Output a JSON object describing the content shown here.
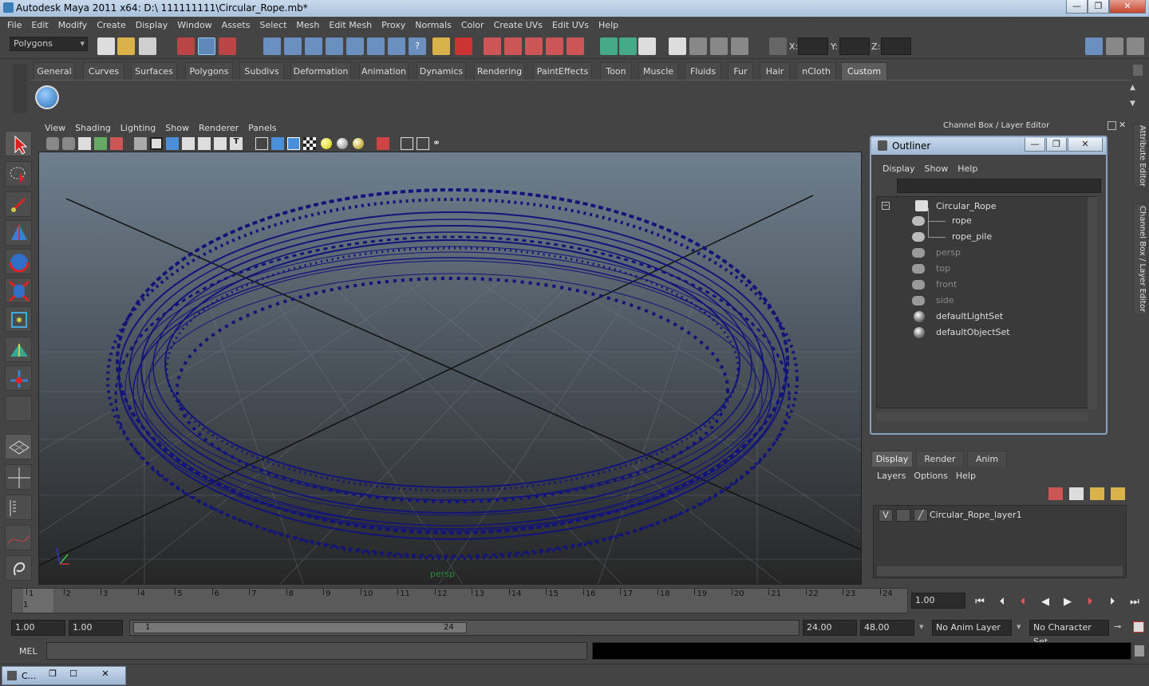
{
  "window": {
    "title": "Autodesk Maya 2011 x64: D:\\ 111111111\\Circular_Rope.mb*",
    "min": "—",
    "max": "❐",
    "close": "✕"
  },
  "menubar": [
    "File",
    "Edit",
    "Modify",
    "Create",
    "Display",
    "Window",
    "Assets",
    "Select",
    "Mesh",
    "Edit Mesh",
    "Proxy",
    "Normals",
    "Color",
    "Create UVs",
    "Edit UVs",
    "Help"
  ],
  "status": {
    "mode": "Polygons",
    "x_label": "X:",
    "y_label": "Y:",
    "z_label": "Z:"
  },
  "shelf_tabs": [
    "General",
    "Curves",
    "Surfaces",
    "Polygons",
    "Subdivs",
    "Deformation",
    "Animation",
    "Dynamics",
    "Rendering",
    "PaintEffects",
    "Toon",
    "Muscle",
    "Fluids",
    "Fur",
    "Hair",
    "nCloth",
    "Custom"
  ],
  "shelf_active": "Custom",
  "panel_menu": [
    "View",
    "Shading",
    "Lighting",
    "Show",
    "Renderer",
    "Panels"
  ],
  "viewport": {
    "camera_label": "persp"
  },
  "channel_box_title": "Channel Box / Layer Editor",
  "side_tabs": {
    "attribute": "Attribute Editor",
    "channel": "Channel Box / Layer Editor"
  },
  "outliner": {
    "title": "Outliner",
    "menu": [
      "Display",
      "Show",
      "Help"
    ],
    "items": [
      {
        "label": "Circular_Rope",
        "dim": false
      },
      {
        "label": "rope",
        "dim": false
      },
      {
        "label": "rope_pile",
        "dim": false
      },
      {
        "label": "persp",
        "dim": true
      },
      {
        "label": "top",
        "dim": true
      },
      {
        "label": "front",
        "dim": true
      },
      {
        "label": "side",
        "dim": true
      },
      {
        "label": "defaultLightSet",
        "dim": false
      },
      {
        "label": "defaultObjectSet",
        "dim": false
      }
    ]
  },
  "layer_editor": {
    "tabs": [
      "Display",
      "Render",
      "Anim"
    ],
    "menu": [
      "Layers",
      "Options",
      "Help"
    ],
    "layer": {
      "visible": "V",
      "name": "Circular_Rope_layer1"
    }
  },
  "timeline": {
    "ticks": [
      "1",
      "2",
      "3",
      "4",
      "5",
      "6",
      "7",
      "8",
      "9",
      "10",
      "11",
      "12",
      "13",
      "14",
      "15",
      "16",
      "17",
      "18",
      "19",
      "20",
      "21",
      "22",
      "23",
      "24"
    ],
    "current_frame_marker": "1",
    "current_time": "1.00"
  },
  "range": {
    "start": "1.00",
    "playback_start": "1.00",
    "slider_start": "1",
    "slider_end": "24",
    "playback_end": "24.00",
    "end": "48.00",
    "anim_layer": "No Anim Layer",
    "character_set": "No Character Set"
  },
  "cmdline": {
    "label": "MEL"
  },
  "taskbar": {
    "item": "C..."
  }
}
